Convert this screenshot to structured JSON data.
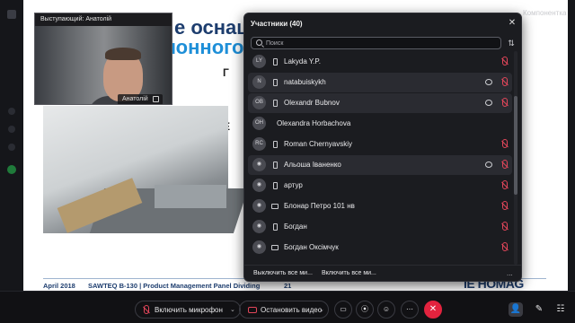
{
  "slide": {
    "title_line1": "е оснащен",
    "title_line2": "лонного р",
    "bullet1": "Г",
    "bullet2": "E",
    "footer_date": "April 2018",
    "footer_product": "SAWTEQ B-130 | Product Management Panel Dividing",
    "footer_page": "21",
    "footer_logo": "IE HOMAG"
  },
  "company_label": "Компонентка",
  "speaker": {
    "header": "Выступающий: Анатолій",
    "name": "Анатолій"
  },
  "participants_panel": {
    "title": "Участники (40)",
    "close_glyph": "✕",
    "search_placeholder": "Поиск",
    "sort_glyph": "⇅",
    "participants": [
      {
        "initials": "LY",
        "name": "Lakyda Y.P.",
        "device": "mobile",
        "chat": false,
        "highlighted": false
      },
      {
        "initials": "N",
        "name": "natabuiskykh",
        "device": "mobile",
        "chat": true,
        "highlighted": true
      },
      {
        "initials": "OB",
        "name": "Olexandr Bubnov",
        "device": "mobile",
        "chat": true,
        "highlighted": true
      },
      {
        "initials": "OH",
        "name": "Olexandra Horbachova",
        "device": "none",
        "chat": false,
        "highlighted": false
      },
      {
        "initials": "RC",
        "name": "Roman Chernyavskiy",
        "device": "mobile",
        "chat": false,
        "highlighted": false
      },
      {
        "initials": "",
        "name": "Альоша Іваненко",
        "device": "mobile",
        "chat": true,
        "highlighted": true
      },
      {
        "initials": "",
        "name": "артур",
        "device": "mobile",
        "chat": false,
        "highlighted": false
      },
      {
        "initials": "",
        "name": "Блонар Петро 101 нв",
        "device": "desktop",
        "chat": false,
        "highlighted": false
      },
      {
        "initials": "",
        "name": "Богдан",
        "device": "mobile",
        "chat": false,
        "highlighted": false
      },
      {
        "initials": "",
        "name": "Богдан Оксімчук",
        "device": "desktop",
        "chat": false,
        "highlighted": false
      }
    ],
    "footer_mute_all": "Выключить все ми...",
    "footer_unmute_all": "Включить все ми...",
    "footer_more": "..."
  },
  "toolbar": {
    "mic_label": "Включить микрофон",
    "video_label": "Остановить видео",
    "chevron": "⌄",
    "share_glyph": "▭",
    "record_glyph": "⦿",
    "reactions_glyph": "☺",
    "more_glyph": "⋯",
    "end_glyph": "✕",
    "participants_glyph": "👤",
    "chat_glyph": "✎",
    "apps_glyph": "☷"
  },
  "colors": {
    "accent_red": "#e2233e",
    "mute_red": "#e2465a",
    "panel_bg": "#1b1c20",
    "slide_title_dark": "#1d3d6e",
    "slide_title_blue": "#1e8fd8"
  }
}
